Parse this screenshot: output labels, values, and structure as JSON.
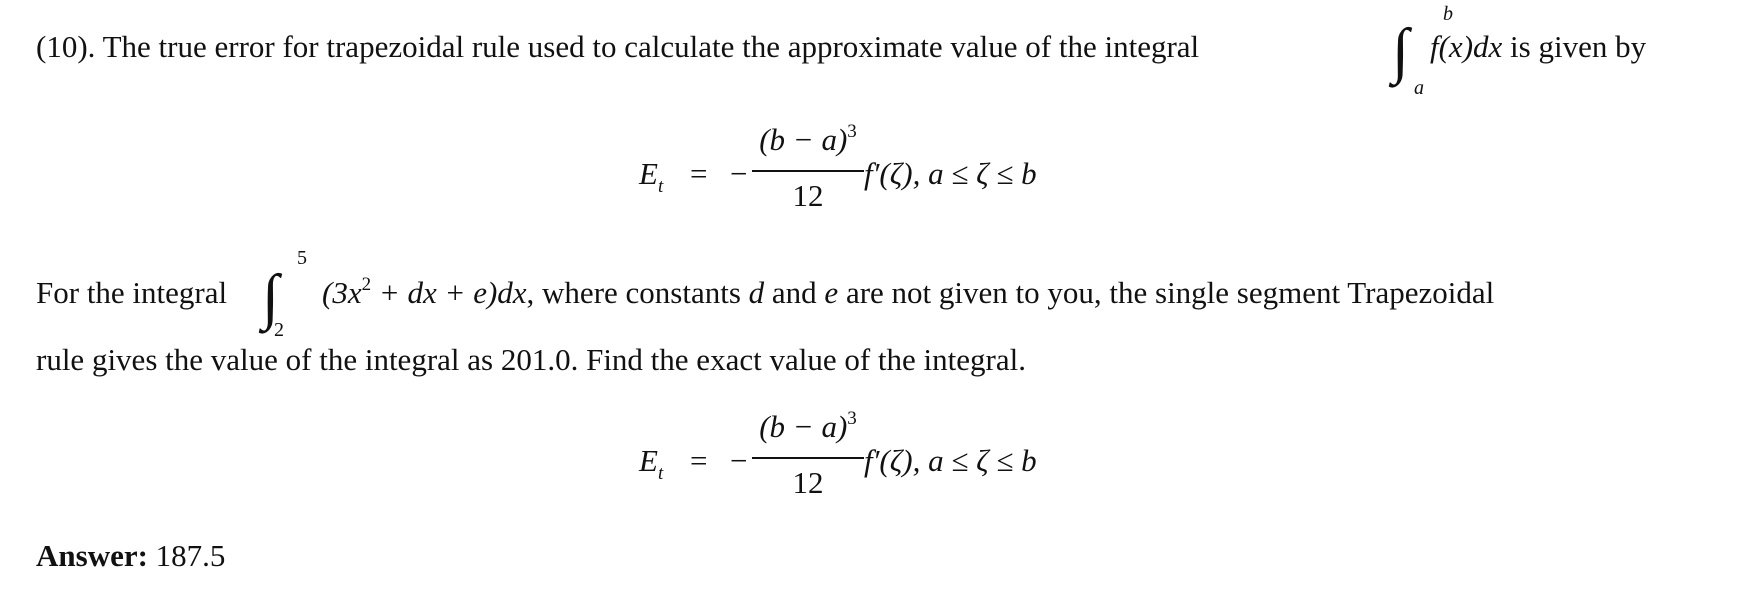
{
  "question": {
    "number": "(10).",
    "intro_text": "The true error for trapezoidal rule used to calculate the approximate value of the integral",
    "intro_integral": {
      "upper": "b",
      "lower": "a",
      "integrand": "f(x)dx"
    },
    "intro_tail": "is given by",
    "formula": {
      "lhs": "E",
      "lhs_sub": "t",
      "equals": "=",
      "minus": "−",
      "numerator": "(b − a)",
      "numerator_exp": "3",
      "denominator": "12",
      "rest": "f′(ζ), a ≤ ζ ≤ b"
    },
    "body_prefix": "For the integral",
    "body_integral": {
      "upper": "5",
      "lower": "2",
      "integrand_pre": "(3x",
      "integrand_exp": "2",
      "integrand_post": " + dx + e)dx"
    },
    "body_text_1a": ", where constants ",
    "var_d": "d",
    "body_text_1b": " and ",
    "var_e": "e",
    "body_text_1c": " are not given to you, the single segment Trapezoidal",
    "body_text_2": "rule gives the value of the integral as 201.0. Find the exact value of the integral.",
    "answer_label": "Answer:",
    "answer_value": "187.5"
  }
}
